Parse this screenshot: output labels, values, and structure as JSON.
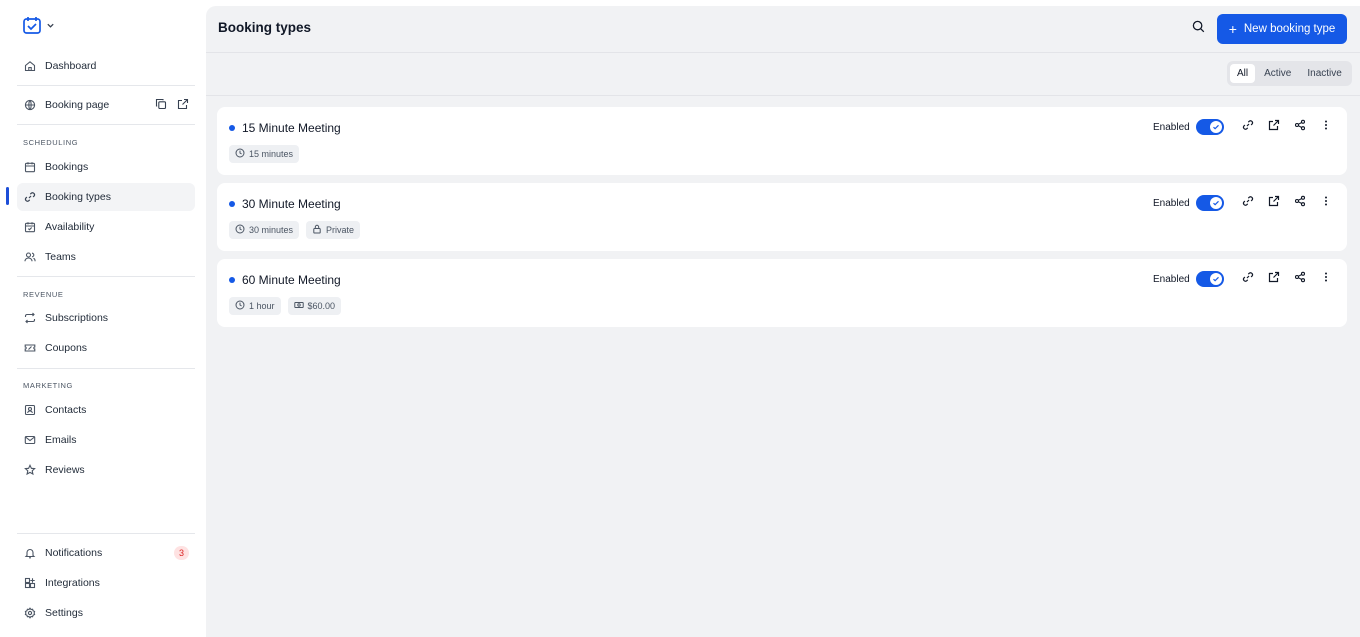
{
  "sidebar": {
    "top_items": [
      {
        "label": "Dashboard",
        "icon": "home-icon"
      },
      {
        "label": "Booking page",
        "icon": "globe-icon"
      }
    ],
    "sections": [
      {
        "title": "SCHEDULING",
        "items": [
          {
            "label": "Bookings",
            "icon": "calendar-icon"
          },
          {
            "label": "Booking types",
            "icon": "link-icon",
            "active": true
          },
          {
            "label": "Availability",
            "icon": "calendar-check-icon"
          },
          {
            "label": "Teams",
            "icon": "users-icon"
          }
        ]
      },
      {
        "title": "REVENUE",
        "items": [
          {
            "label": "Subscriptions",
            "icon": "repeat-icon"
          },
          {
            "label": "Coupons",
            "icon": "ticket-icon"
          }
        ]
      },
      {
        "title": "MARKETING",
        "items": [
          {
            "label": "Contacts",
            "icon": "contact-icon"
          },
          {
            "label": "Emails",
            "icon": "mail-icon"
          },
          {
            "label": "Reviews",
            "icon": "star-icon"
          }
        ]
      }
    ],
    "bottom_items": [
      {
        "label": "Notifications",
        "icon": "bell-icon",
        "badge": "3"
      },
      {
        "label": "Integrations",
        "icon": "grid-plus-icon"
      },
      {
        "label": "Settings",
        "icon": "gear-icon"
      }
    ]
  },
  "header": {
    "title": "Booking types",
    "new_button_label": "New booking type"
  },
  "filters": {
    "options": [
      "All",
      "Active",
      "Inactive"
    ],
    "selected": "All"
  },
  "booking_types": [
    {
      "name": "15 Minute Meeting",
      "status_label": "Enabled",
      "enabled": true,
      "chips": [
        {
          "icon": "clock-icon",
          "text": "15 minutes"
        }
      ]
    },
    {
      "name": "30 Minute Meeting",
      "status_label": "Enabled",
      "enabled": true,
      "chips": [
        {
          "icon": "clock-icon",
          "text": "30 minutes"
        },
        {
          "icon": "lock-icon",
          "text": "Private"
        }
      ]
    },
    {
      "name": "60 Minute Meeting",
      "status_label": "Enabled",
      "enabled": true,
      "chips": [
        {
          "icon": "clock-icon",
          "text": "1 hour"
        },
        {
          "icon": "money-icon",
          "text": "$60.00"
        }
      ]
    }
  ],
  "colors": {
    "accent": "#1559e6",
    "badge_bg": "#fee2e2",
    "badge_text": "#dc2626"
  }
}
